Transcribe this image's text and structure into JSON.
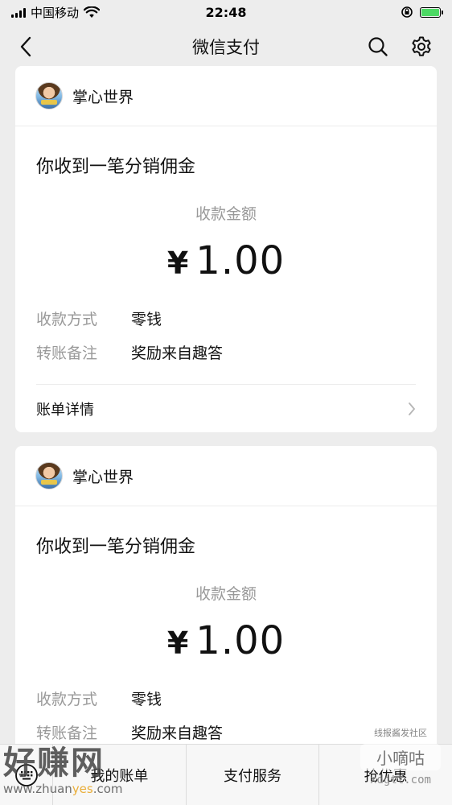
{
  "status_bar": {
    "carrier": "中国移动",
    "time": "22:48"
  },
  "nav": {
    "title": "微信支付"
  },
  "messages": [
    {
      "merchant": "掌心世界",
      "title": "你收到一笔分销佣金",
      "amount_label": "收款金额",
      "currency": "¥",
      "amount": "1.00",
      "method_label": "收款方式",
      "method_value": "零钱",
      "note_label": "转账备注",
      "note_value": "奖励来自趣答",
      "detail_label": "账单详情"
    },
    {
      "merchant": "掌心世界",
      "title": "你收到一笔分销佣金",
      "amount_label": "收款金额",
      "currency": "¥",
      "amount": "1.00",
      "method_label": "收款方式",
      "method_value": "零钱",
      "note_label": "转账备注",
      "note_value": "奖励来自趣答"
    }
  ],
  "tabbar": {
    "tab1": "我的账单",
    "tab2": "支付服务",
    "tab3": "抢优惠"
  },
  "watermarks": {
    "left_big": "好赚网",
    "left_url_a": "www.zhuan",
    "left_url_b": "yes",
    "left_url_c": ".com",
    "right_small": "线报酱发社区",
    "right_mid": "小嘀咕",
    "right_url": "xdgtt.com"
  }
}
